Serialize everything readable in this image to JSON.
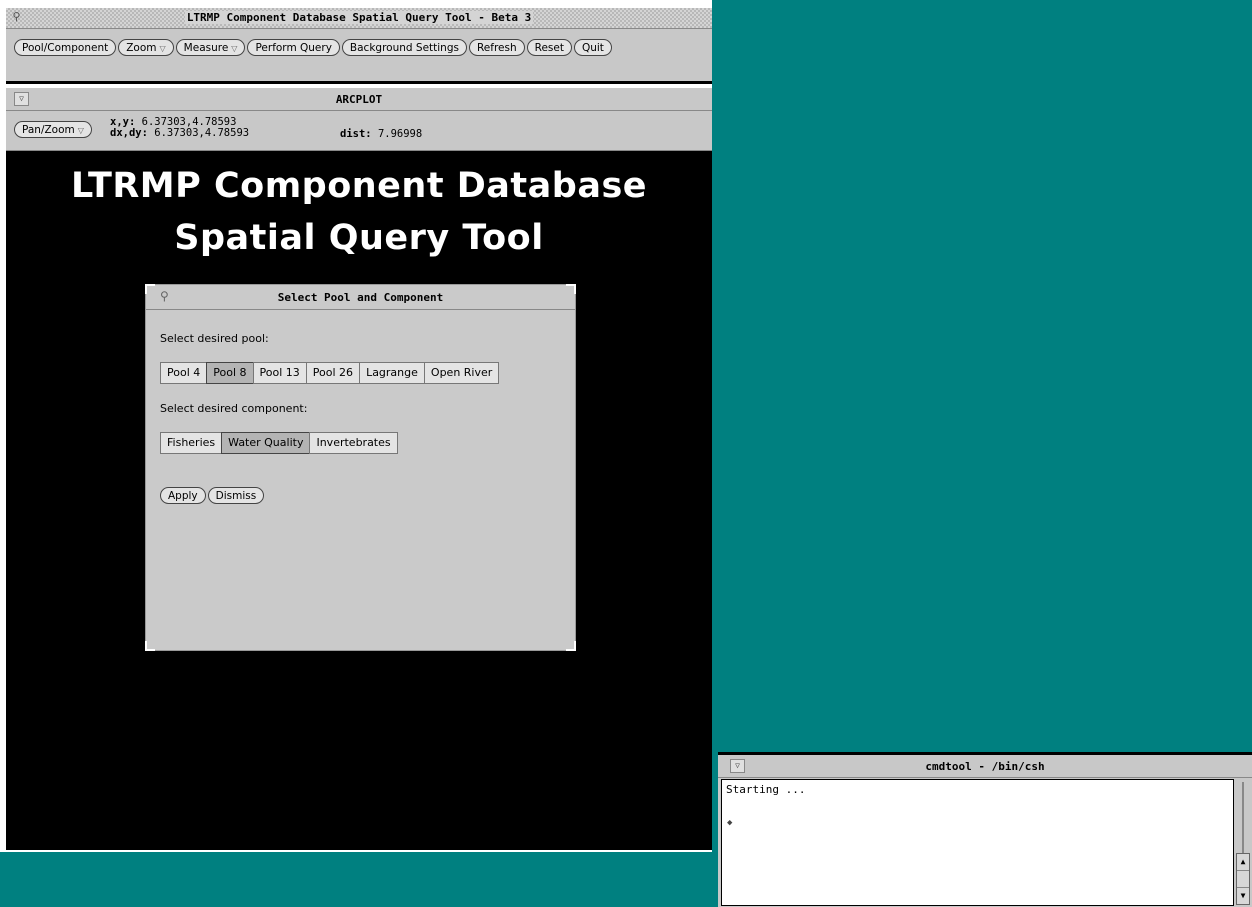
{
  "main_window": {
    "title": "LTRMP Component Database Spatial Query Tool - Beta 3",
    "buttons": [
      {
        "label": "Pool/Component",
        "menu": false
      },
      {
        "label": "Zoom",
        "menu": true
      },
      {
        "label": "Measure",
        "menu": true
      },
      {
        "label": "Perform Query",
        "menu": false
      },
      {
        "label": "Background Settings",
        "menu": false
      },
      {
        "label": "Refresh",
        "menu": false
      },
      {
        "label": "Reset",
        "menu": false
      },
      {
        "label": "Quit",
        "menu": false
      }
    ]
  },
  "arcplot": {
    "title": "ARCPLOT",
    "panzoom_label": "Pan/Zoom",
    "xy_label": "x,y:",
    "xy_value": "6.37303,4.78593",
    "dxdy_label": "dx,dy:",
    "dxdy_value": "6.37303,4.78593",
    "dist_label": "dist:",
    "dist_value": "7.96998",
    "heading_line1": "LTRMP Component Database",
    "heading_line2": "Spatial Query Tool"
  },
  "dialog": {
    "title": "Select Pool and Component",
    "pool_prompt": "Select desired pool:",
    "pools": [
      "Pool 4",
      "Pool 8",
      "Pool 13",
      "Pool 26",
      "Lagrange",
      "Open River"
    ],
    "selected_pool": "Pool 8",
    "component_prompt": "Select desired component:",
    "components": [
      "Fisheries",
      "Water Quality",
      "Invertebrates"
    ],
    "selected_component": "Water Quality",
    "apply_label": "Apply",
    "dismiss_label": "Dismiss"
  },
  "cmdtool": {
    "title": "cmdtool - /bin/csh",
    "output": "Starting ...",
    "cursor": "◆"
  },
  "colors": {
    "desktop": "#008080",
    "panel": "#c8c8c8",
    "canvas": "#000000",
    "heading": "#ffffff"
  }
}
